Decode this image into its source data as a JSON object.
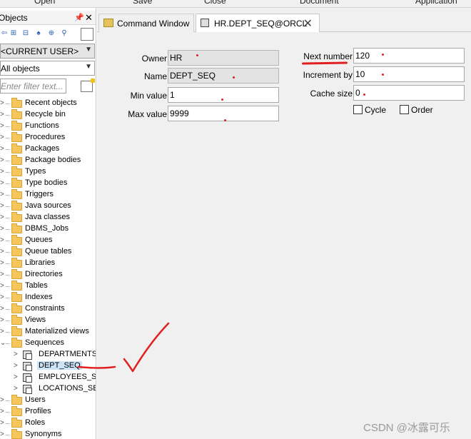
{
  "menu": {
    "open": "Open",
    "save": "Save",
    "close": "Close",
    "document": "Document",
    "application": "Application"
  },
  "left_panel": {
    "title": "Objects",
    "pin": "📌",
    "close": "✕",
    "user_combo": "<CURRENT USER>",
    "objects_combo": "All objects",
    "filter_placeholder": "Enter filter text...",
    "tree": [
      "Recent objects",
      "Recycle bin",
      "Functions",
      "Procedures",
      "Packages",
      "Package bodies",
      "Types",
      "Type bodies",
      "Triggers",
      "Java sources",
      "Java classes",
      "DBMS_Jobs",
      "Queues",
      "Queue tables",
      "Libraries",
      "Directories",
      "Tables",
      "Indexes",
      "Constraints",
      "Views",
      "Materialized views",
      "Sequences"
    ],
    "sequences": [
      "DEPARTMENTS_SEQ",
      "DEPT_SEQ",
      "EMPLOYEES_SEQ",
      "LOCATIONS_SEQ"
    ],
    "tree_after": [
      "Users",
      "Profiles",
      "Roles",
      "Synonyms"
    ]
  },
  "tabs": {
    "command_window": "Command Window",
    "sequence_tab": "HR.DEPT_SEQ@ORCL",
    "close": "✕"
  },
  "form": {
    "owner_label": "Owner",
    "owner_value": "HR",
    "name_label": "Name",
    "name_value": "DEPT_SEQ",
    "min_label": "Min value",
    "min_value": "1",
    "max_label": "Max value",
    "max_value": "9999",
    "next_label": "Next number",
    "next_value": "120",
    "incr_label": "Increment by",
    "incr_value": "10",
    "cache_label": "Cache size",
    "cache_value": "0",
    "cycle_label": "Cycle",
    "order_label": "Order"
  },
  "watermark": "CSDN @冰露可乐",
  "colors": {
    "annotation": "#e02020",
    "selection": "#cce4f7"
  }
}
